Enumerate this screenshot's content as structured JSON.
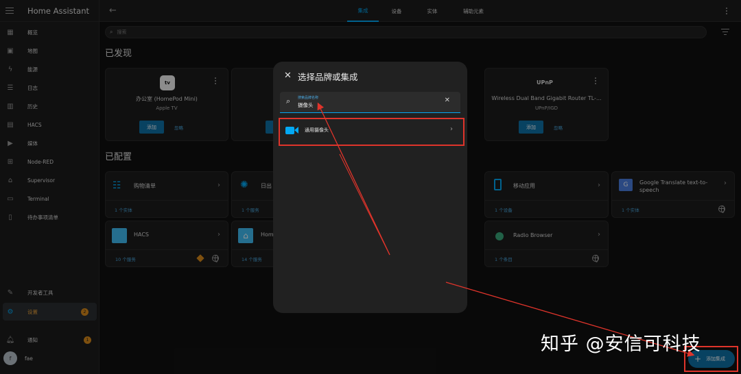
{
  "app": {
    "title": "Home Assistant"
  },
  "sidebar": {
    "items": [
      {
        "label": "概览",
        "icon": "dashboard-icon"
      },
      {
        "label": "地图",
        "icon": "map-icon"
      },
      {
        "label": "能源",
        "icon": "lightning-icon"
      },
      {
        "label": "日志",
        "icon": "list-icon"
      },
      {
        "label": "历史",
        "icon": "chart-icon"
      },
      {
        "label": "HACS",
        "icon": "hacs-icon"
      },
      {
        "label": "媒体",
        "icon": "play-icon"
      },
      {
        "label": "Node-RED",
        "icon": "sitemap-icon"
      },
      {
        "label": "Supervisor",
        "icon": "home-assistant-icon"
      },
      {
        "label": "Terminal",
        "icon": "console-icon"
      },
      {
        "label": "待办事项清单",
        "icon": "clipboard-icon"
      }
    ],
    "dev_tools": "开发者工具",
    "settings": "设置",
    "settings_badge": "2",
    "notifications": "通知",
    "notifications_badge": "1",
    "user_initial": "f",
    "user_name": "fae"
  },
  "topbar": {
    "tabs": [
      "集成",
      "设备",
      "实体",
      "辅助元素"
    ],
    "active_tab": "集成"
  },
  "search": {
    "placeholder": "搜索"
  },
  "discovered": {
    "title": "已发现",
    "cards": [
      {
        "logo": "tv",
        "name": "办公室 (HomePod Mini)",
        "sub": "Apple TV",
        "add": "添加",
        "ignore": "忽略"
      },
      {
        "logo": "",
        "name": "",
        "sub": "",
        "add": "",
        "ignore": ""
      },
      {
        "logo": "UPnP",
        "name": "Wireless Dual Band Gigabit Router TL-...",
        "sub": "UPnP/IGD",
        "add": "添加",
        "ignore": "忽略"
      }
    ]
  },
  "configured": {
    "title": "已配置",
    "cards": [
      {
        "title": "购物清单",
        "link": "1 个实体"
      },
      {
        "title": "日出",
        "link": "1 个服务"
      },
      {
        "title": "移动应用",
        "link": "1 个设备"
      },
      {
        "title": "Google Translate text-to-speech",
        "link": "1 个实体"
      },
      {
        "title": "HACS",
        "link": "10 个服务"
      },
      {
        "title": "Hom",
        "link": "14 个服务"
      },
      {
        "title": "Radio Browser",
        "link": "1 个条目"
      }
    ]
  },
  "dialog": {
    "title": "选择品牌或集成",
    "field_label": "搜索品牌名称",
    "field_value": "摄像头",
    "result_label": "通用摄像头"
  },
  "fab": {
    "label": "添加集成"
  },
  "watermark": "知乎 @安信可科技",
  "colors": {
    "accent": "#03a9f4",
    "highlight": "#e0342b",
    "badge": "#d98a1b"
  }
}
